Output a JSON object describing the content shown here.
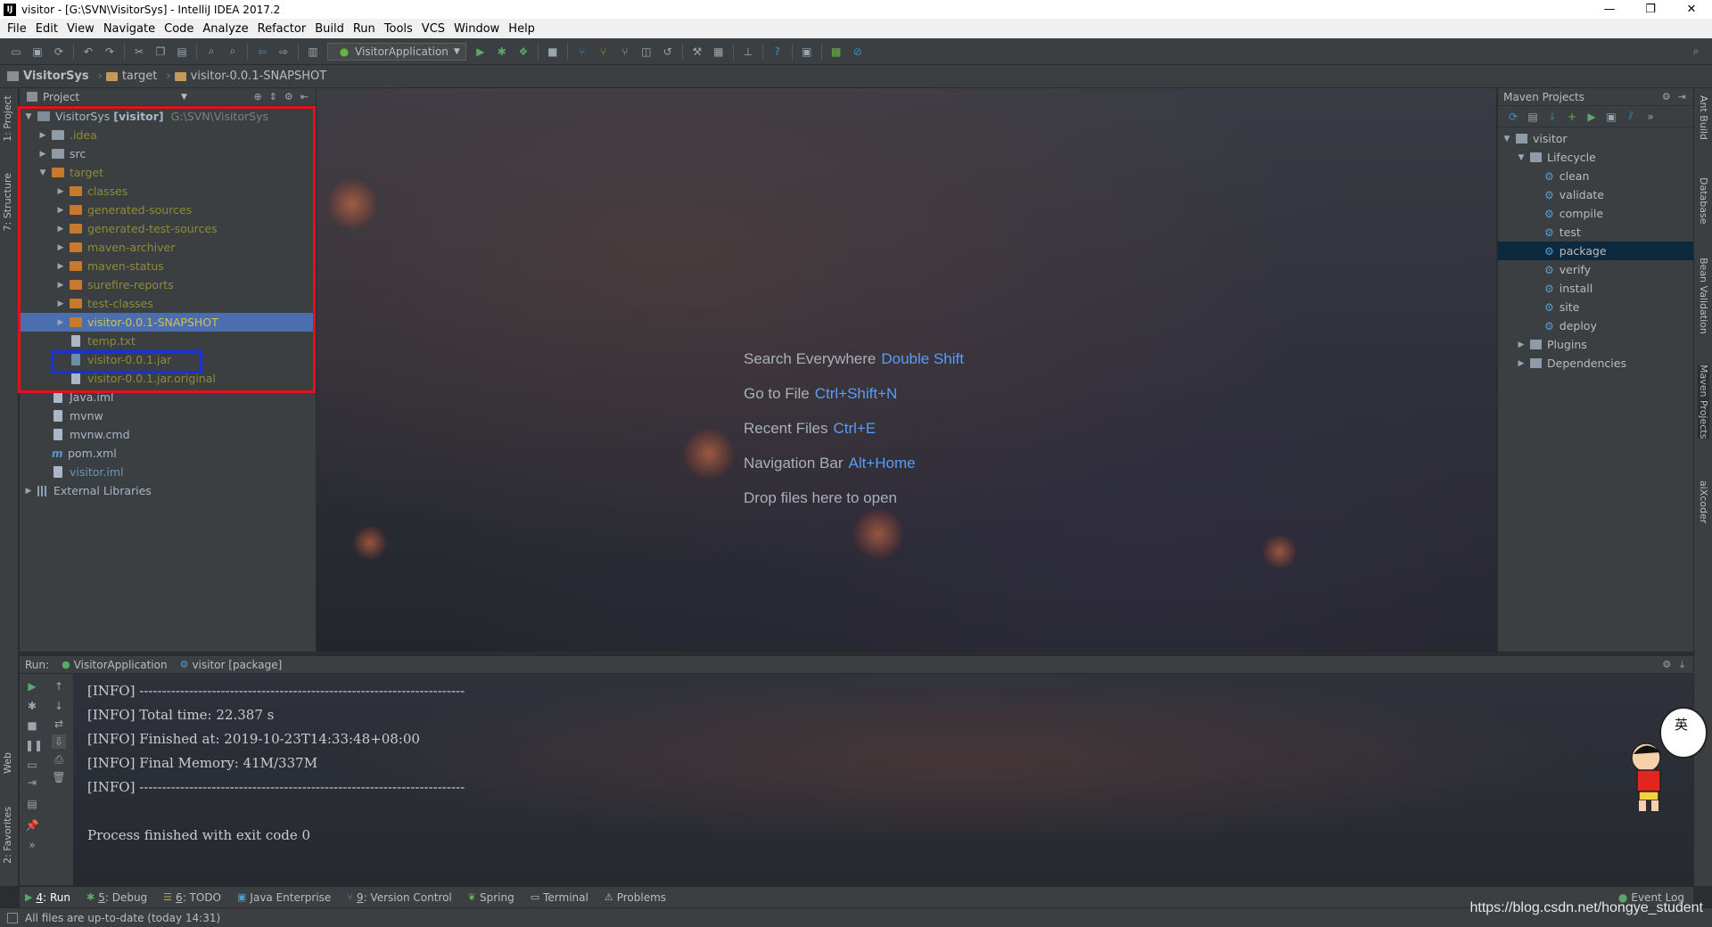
{
  "window": {
    "title": "visitor - [G:\\SVN\\VisitorSys] - IntelliJ IDEA 2017.2",
    "minimize": "—",
    "maximize": "❐",
    "close": "✕"
  },
  "menu": [
    "File",
    "Edit",
    "View",
    "Navigate",
    "Code",
    "Analyze",
    "Refactor",
    "Build",
    "Run",
    "Tools",
    "VCS",
    "Window",
    "Help"
  ],
  "toolbar": {
    "run_config": "VisitorApplication"
  },
  "breadcrumb": [
    "VisitorSys",
    "target",
    "visitor-0.0.1-SNAPSHOT"
  ],
  "left_stripe": {
    "project_tab": "1: Project",
    "structure_tab": "7: Structure",
    "web_tab": "Web",
    "favorites_tab": "2: Favorites"
  },
  "right_stripe": {
    "ant_tab": "Ant Build",
    "database_tab": "Database",
    "bean_tab": "Bean Validation",
    "maven_tab": "Maven Projects",
    "aixcoder_tab": "aiXcoder"
  },
  "project_panel": {
    "title": "Project",
    "root_name": "VisitorSys",
    "root_module": "[visitor]",
    "root_path": "G:\\SVN\\VisitorSys",
    "items": [
      {
        "label": ".idea"
      },
      {
        "label": "src"
      },
      {
        "label": "target"
      },
      {
        "label": "classes"
      },
      {
        "label": "generated-sources"
      },
      {
        "label": "generated-test-sources"
      },
      {
        "label": "maven-archiver"
      },
      {
        "label": "maven-status"
      },
      {
        "label": "surefire-reports"
      },
      {
        "label": "test-classes"
      },
      {
        "label": "visitor-0.0.1-SNAPSHOT"
      },
      {
        "label": "temp.txt"
      },
      {
        "label": "visitor-0.0.1.jar"
      },
      {
        "label": "visitor-0.0.1.jar.original"
      },
      {
        "label": "Java.iml"
      },
      {
        "label": "mvnw"
      },
      {
        "label": "mvnw.cmd"
      },
      {
        "label": "pom.xml"
      },
      {
        "label": "visitor.iml"
      },
      {
        "label": "External Libraries"
      }
    ]
  },
  "editor": {
    "hints": [
      {
        "label": "Search Everywhere",
        "key": "Double Shift"
      },
      {
        "label": "Go to File",
        "key": "Ctrl+Shift+N"
      },
      {
        "label": "Recent Files",
        "key": "Ctrl+E"
      },
      {
        "label": "Navigation Bar",
        "key": "Alt+Home"
      },
      {
        "label": "Drop files here to open",
        "key": ""
      }
    ]
  },
  "maven_panel": {
    "title": "Maven Projects",
    "project": "visitor",
    "lifecycle": "Lifecycle",
    "goals": [
      "clean",
      "validate",
      "compile",
      "test",
      "package",
      "verify",
      "install",
      "site",
      "deploy"
    ],
    "selected_goal": "package",
    "plugins": "Plugins",
    "dependencies": "Dependencies"
  },
  "run_panel": {
    "label": "Run:",
    "tabs": [
      "VisitorApplication",
      "visitor [package]"
    ],
    "console": [
      "[INFO] ------------------------------------------------------------------------",
      "[INFO] Total time: 22.387 s",
      "[INFO] Finished at: 2019-10-23T14:33:48+08:00",
      "[INFO] Final Memory: 41M/337M",
      "[INFO] ------------------------------------------------------------------------"
    ],
    "exit_message": "Process finished with exit code 0"
  },
  "bottom_tabs": [
    {
      "num": "4",
      "label": ": Run"
    },
    {
      "num": "5",
      "label": ": Debug"
    },
    {
      "num": "6",
      "label": ": TODO"
    },
    {
      "num": "",
      "label": "Java Enterprise"
    },
    {
      "num": "9",
      "label": ": Version Control"
    },
    {
      "num": "",
      "label": "Spring"
    },
    {
      "num": "",
      "label": "Terminal"
    },
    {
      "num": "",
      "label": "Problems"
    }
  ],
  "event_log": "Event Log",
  "status": {
    "message": "All files are up-to-date (today 14:31)"
  },
  "watermark": "https://blog.csdn.net/hongye_student",
  "mascot_text": "英"
}
